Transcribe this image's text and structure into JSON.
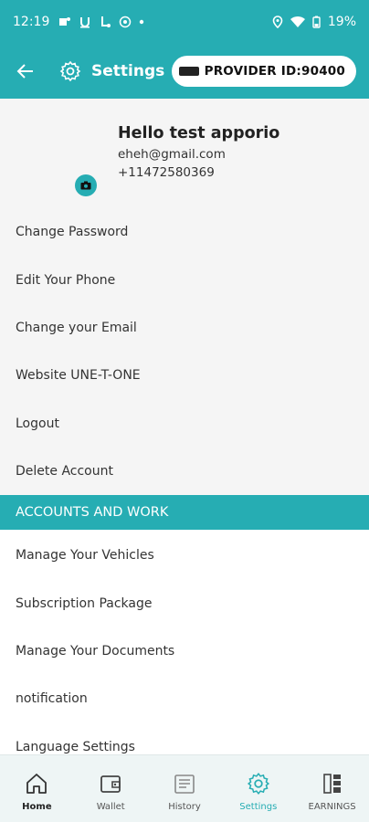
{
  "status": {
    "time": "12:19",
    "battery": "19%"
  },
  "header": {
    "title": "Settings",
    "provider_id": "PROVIDER ID:90400"
  },
  "profile": {
    "name": "Hello test apporio",
    "email": "eheh@gmail.com",
    "phone": "+11472580369"
  },
  "menu": [
    {
      "label": "Change Password"
    },
    {
      "label": "Edit Your Phone"
    },
    {
      "label": "Change your Email"
    },
    {
      "label": "Website UNE-T-ONE"
    },
    {
      "label": "Logout"
    },
    {
      "label": "Delete Account"
    }
  ],
  "section": {
    "title": "ACCOUNTS AND WORK"
  },
  "work_menu": [
    {
      "label": "Manage Your Vehicles"
    },
    {
      "label": "Subscription Package"
    },
    {
      "label": "Manage Your Documents"
    },
    {
      "label": "notification"
    },
    {
      "label": "Language Settings"
    }
  ],
  "nav": [
    {
      "label": "Home",
      "icon": "home-icon"
    },
    {
      "label": "Wallet",
      "icon": "wallet-icon"
    },
    {
      "label": "History",
      "icon": "history-icon"
    },
    {
      "label": "Settings",
      "icon": "gear-icon"
    },
    {
      "label": "EARNINGS",
      "icon": "earnings-icon"
    }
  ],
  "colors": {
    "accent": "#26adb3",
    "panel": "#f5f5f5",
    "nav_bg": "#eef5f5"
  }
}
